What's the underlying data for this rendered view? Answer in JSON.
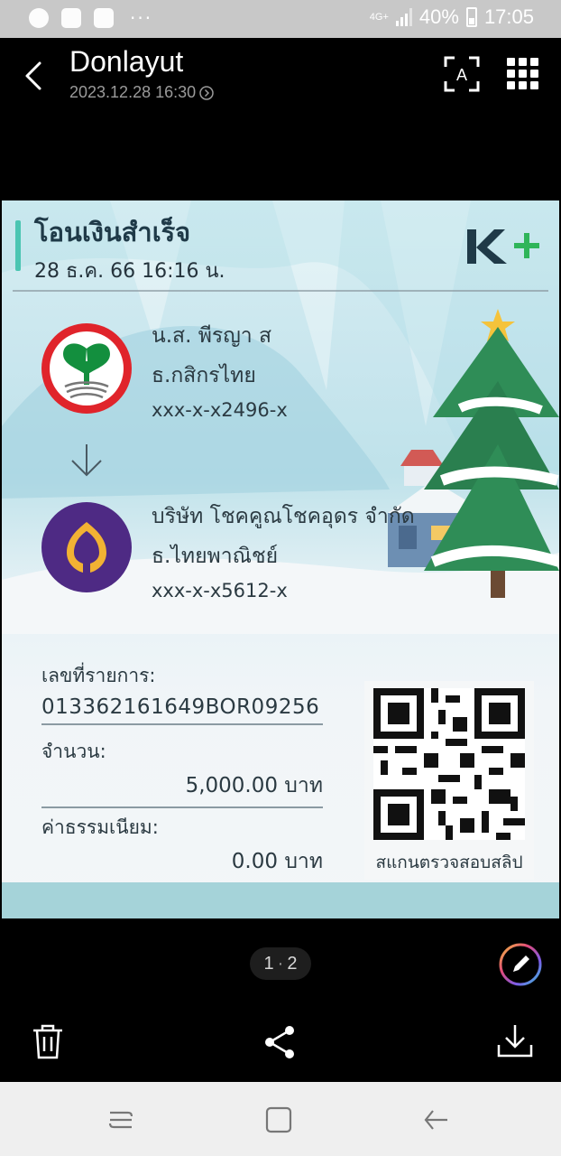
{
  "status_bar": {
    "network": "4G+",
    "battery": "40%",
    "time": "17:05",
    "icons": [
      "line-app-icon",
      "gallery-icon",
      "chat-icon",
      "more-icon",
      "signal-icon",
      "battery-icon"
    ]
  },
  "header": {
    "title": "Donlayut",
    "subtitle": "2023.12.28 16:30"
  },
  "slip": {
    "title": "โอนเงินสำเร็จ",
    "date": "28 ธ.ค. 66  16:16 น.",
    "brand": "K+",
    "from": {
      "name": "น.ส. พีรญา ส",
      "bank": "ธ.กสิกรไทย",
      "account": "xxx-x-x2496-x"
    },
    "to": {
      "name": "บริษัท โชคคูณโชคอุดร จำกัด",
      "bank": "ธ.ไทยพาณิชย์",
      "account": "xxx-x-x5612-x"
    },
    "ref_label": "เลขที่รายการ:",
    "ref_value": "013362161649BOR09256",
    "amount_label": "จำนวน:",
    "amount_value": "5,000.00 บาท",
    "fee_label": "ค่าธรรมเนียม:",
    "fee_value": "0.00 บาท",
    "qr_caption": "สแกนตรวจสอบสลิป",
    "colors": {
      "accent": "#4ac5b2",
      "kbank_green": "#138f3e",
      "kbank_red": "#e0242b",
      "scb_purple": "#4e2a84",
      "scb_gold": "#f2b233"
    }
  },
  "viewer": {
    "page_current": "1",
    "page_total": "2"
  }
}
